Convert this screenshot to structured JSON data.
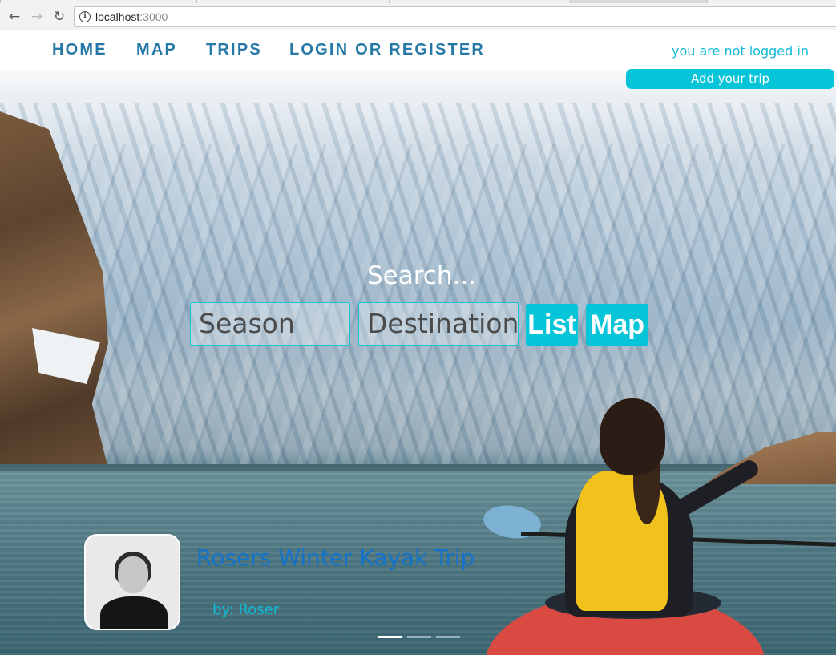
{
  "browser": {
    "url_host": "localhost",
    "url_port": ":3000"
  },
  "nav": {
    "items": [
      {
        "label": "HOME"
      },
      {
        "label": "MAP"
      },
      {
        "label": "TRIPS"
      },
      {
        "label": "LOGIN OR REGISTER"
      }
    ],
    "login_status": "you are not logged in",
    "add_trip_label": "Add your trip"
  },
  "search": {
    "title": "Search...",
    "season_placeholder": "Season",
    "destination_placeholder": "Destination",
    "list_label": "List",
    "map_label": "Map"
  },
  "featured_trip": {
    "title": "Rosers Winter Kayak Trip",
    "author": "by: Roser"
  },
  "carousel": {
    "slide_count": 3,
    "active_index": 0
  },
  "colors": {
    "accent": "#07c5d9",
    "nav_text": "#2679a6",
    "trip_title": "#1473c8"
  }
}
